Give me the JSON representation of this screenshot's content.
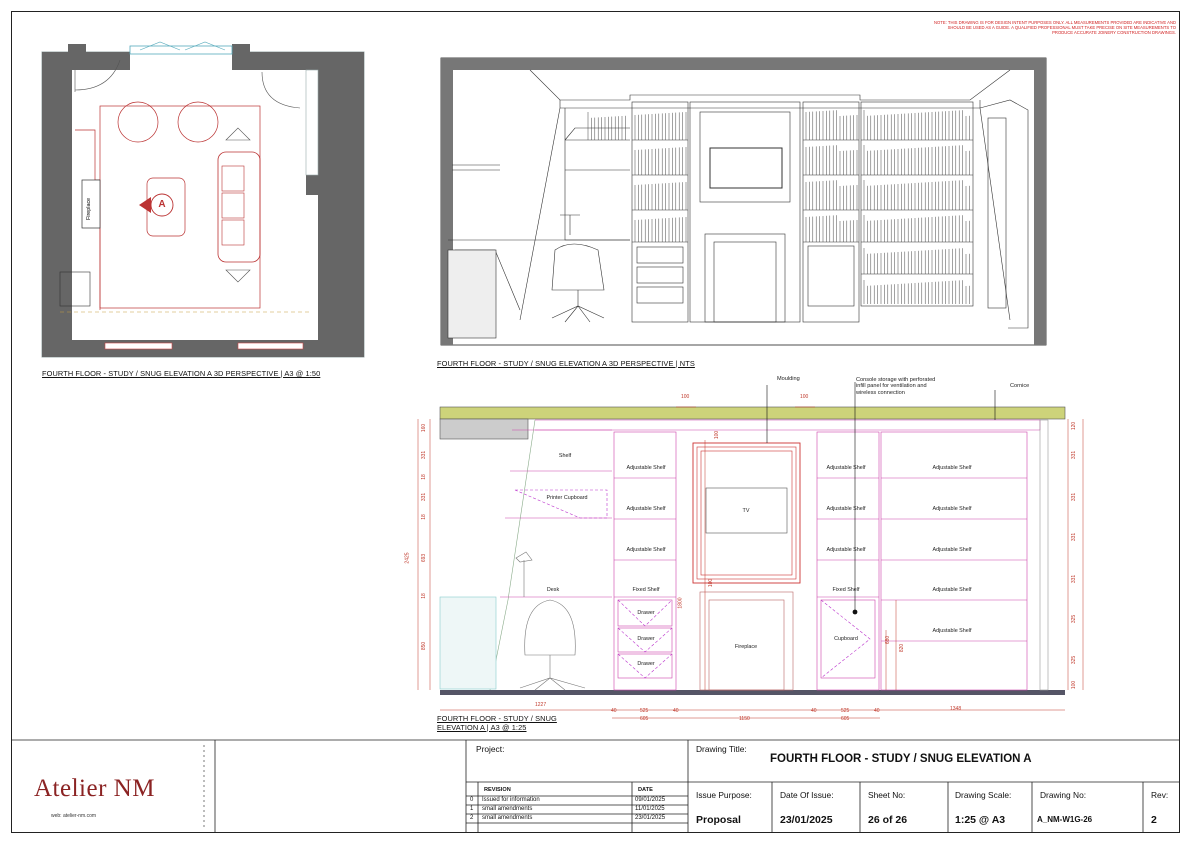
{
  "note": "NOTE: THIS DRAWING IS FOR DESIGN INTENT PURPOSES ONLY. ALL MEASUREMENTS PROVIDED ARE INDICATIVE AND SHOULD BE USED AS A GUIDE. A QUALIFIED PROFESSIONAL MUST TAKE PRECISE ON SITE MEASUREMENTS TO PRODUCE ACCURATE JOINERY CONSTRUCTION DRAWINGS.",
  "plan": {
    "caption": "FOURTH FLOOR - STUDY / SNUG ELEVATION A 3D PERSPECTIVE | A3 @ 1:50",
    "fireplace_label": "Fireplace",
    "marker_label": "A"
  },
  "perspective": {
    "caption": "FOURTH FLOOR - STUDY / SNUG ELEVATION A 3D PERSPECTIVE | NTS"
  },
  "elevation": {
    "caption_line1": "FOURTH FLOOR - STUDY / SNUG",
    "caption_line2": "ELEVATION A | A3 @ 1:25",
    "callouts": {
      "moulding": "Moulding",
      "console": [
        "Console storage with perforated",
        "infill panel for ventilation and",
        "wireless connection"
      ],
      "cornice": "Cornice"
    },
    "labels": {
      "shelf": "Shelf",
      "printer": "Printer Cupboard",
      "desk": "Desk",
      "adjustable_shelf": "Adjustable Shelf",
      "fixed_shelf": "Fixed Shelf",
      "drawer": "Drawer",
      "tv": "TV",
      "fireplace": "Fireplace",
      "cupboard": "Cupboard"
    },
    "dims": {
      "top_100a": "100",
      "top_100b": "100",
      "tv_100": "100",
      "fireplace_100": "100",
      "h_1800": "1800",
      "h_680": "680",
      "h_820": "820",
      "left_2425": "2425",
      "left_160": "160",
      "left_331a": "331",
      "left_331b": "331",
      "left_693": "693",
      "left_850": "850",
      "left_18a": "18",
      "left_18b": "18",
      "left_18c": "18",
      "right_120": "120",
      "right_331a": "331",
      "right_331b": "331",
      "right_331c": "331",
      "right_331d": "331",
      "right_325a": "325",
      "right_325b": "325",
      "right_100": "100",
      "bot_1227": "1227",
      "bot_40a": "40",
      "bot_525a": "525",
      "bot_40b": "40",
      "bot_605a": "605",
      "bot_1150": "1150",
      "bot_40c": "40",
      "bot_525b": "525",
      "bot_40d": "40",
      "bot_605b": "605",
      "bot_1348": "1348"
    }
  },
  "titleblock": {
    "logo": "Atelier NM",
    "web": "web: atelier-nm.com",
    "project_label": "Project:",
    "drawing_title_label": "Drawing Title:",
    "drawing_title": "FOURTH FLOOR - STUDY / SNUG ELEVATION A",
    "revision_header": "REVISION",
    "date_header": "DATE",
    "revisions": [
      {
        "num": "0",
        "desc": "Issued for information",
        "date": "09/01/2025"
      },
      {
        "num": "1",
        "desc": "small amendments",
        "date": "11/01/2025"
      },
      {
        "num": "2",
        "desc": "small amendments",
        "date": "23/01/2025"
      }
    ],
    "issue_purpose_label": "Issue Purpose:",
    "issue_purpose": "Proposal",
    "date_of_issue_label": "Date Of Issue:",
    "date_of_issue": "23/01/2025",
    "sheet_no_label": "Sheet No:",
    "sheet_no": "26 of 26",
    "scale_label": "Drawing Scale:",
    "scale": "1:25 @ A3",
    "drawing_no_label": "Drawing No:",
    "drawing_no": "A_NM-W1G-26",
    "rev_label": "Rev:",
    "rev": "2"
  }
}
